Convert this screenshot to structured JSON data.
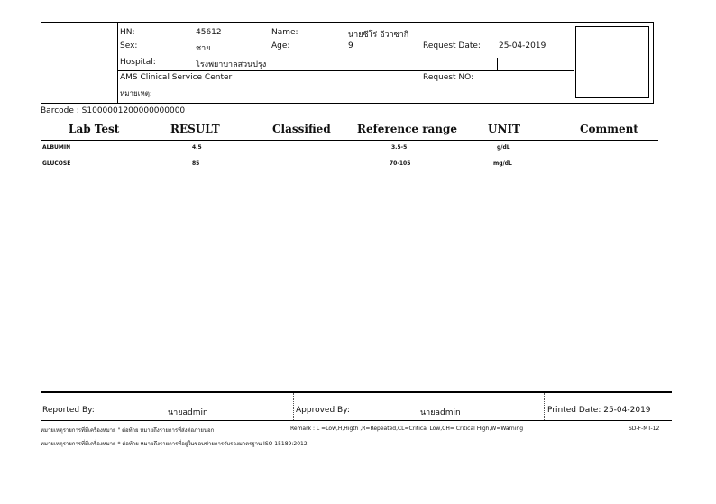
{
  "header": {
    "hn_label": "HN:",
    "hn_value": "45612",
    "name_label": "Name:",
    "name_value": "นายซีโร่ อีวาซากิ",
    "sex_label": "Sex:",
    "sex_value": "ชาย",
    "age_label": "Age:",
    "age_value": "9",
    "request_date_label": "Request Date:",
    "request_date_value": "25-04-2019",
    "hospital_label": "Hospital:",
    "hospital_value": "โรงพยาบาลสวนปรุง",
    "center": "AMS Clinical Service Center",
    "request_no_label": "Request NO:",
    "note_label": "หมายเหตุ:"
  },
  "barcode": "Barcode : S1000001200000000000",
  "table": {
    "columns": [
      "Lab Test",
      "RESULT",
      "Classified",
      "Reference range",
      "UNIT",
      "Comment"
    ],
    "rows": [
      {
        "test": "ALBUMIN",
        "result": "4.5",
        "classified": "",
        "range": "3.5-5",
        "unit": "g/dL",
        "comment": ""
      },
      {
        "test": "GLUCOSE",
        "result": "85",
        "classified": "",
        "range": "70-105",
        "unit": "mg/dL",
        "comment": ""
      }
    ]
  },
  "footer": {
    "reported_label": "Reported By:",
    "reported_value": "นายadmin",
    "approved_label": "Approved By:",
    "approved_value": "นายadmin",
    "printed": "Printed Date: 25-04-2019",
    "note1": "หมายเหตุรายการที่มีเครื่องหมาย \" ต่อท้าย หมายถึงรายการที่ส่งต่อภายนอก",
    "remark": "Remark : L =Low,H,Higth ,R=Repeated,CL=Critical Low,CH= Critical High,W=Warning",
    "doc_code": "SD-F-MT-12",
    "note2": "หมายเหตุรายการที่มีเครื่องหมาย * ต่อท้าย หมายถึงรายการที่อยู่ในขอบข่ายการรับรองมาตรฐาน ISO 15189:2012"
  }
}
